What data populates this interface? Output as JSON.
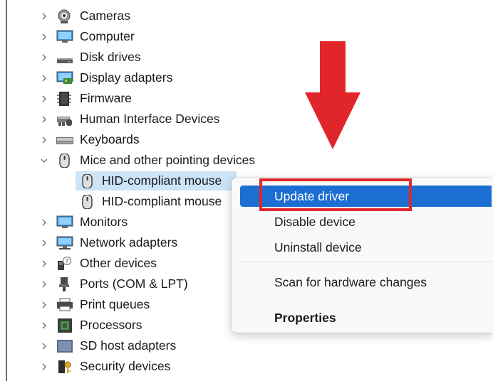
{
  "device_tree": {
    "items": [
      {
        "label": "Cameras",
        "icon": "camera-icon",
        "expanded": false
      },
      {
        "label": "Computer",
        "icon": "computer-icon",
        "expanded": false
      },
      {
        "label": "Disk drives",
        "icon": "disk-drive-icon",
        "expanded": false
      },
      {
        "label": "Display adapters",
        "icon": "display-adapter-icon",
        "expanded": false
      },
      {
        "label": "Firmware",
        "icon": "firmware-icon",
        "expanded": false
      },
      {
        "label": "Human Interface Devices",
        "icon": "hid-icon",
        "expanded": false
      },
      {
        "label": "Keyboards",
        "icon": "keyboard-icon",
        "expanded": false
      },
      {
        "label": "Mice and other pointing devices",
        "icon": "mouse-icon",
        "expanded": true,
        "children": [
          {
            "label": "HID-compliant mouse",
            "icon": "mouse-icon",
            "selected": true
          },
          {
            "label": "HID-compliant mouse",
            "icon": "mouse-icon",
            "selected": false
          }
        ]
      },
      {
        "label": "Monitors",
        "icon": "monitor-icon",
        "expanded": false
      },
      {
        "label": "Network adapters",
        "icon": "network-adapter-icon",
        "expanded": false
      },
      {
        "label": "Other devices",
        "icon": "other-devices-icon",
        "expanded": false
      },
      {
        "label": "Ports (COM & LPT)",
        "icon": "port-icon",
        "expanded": false
      },
      {
        "label": "Print queues",
        "icon": "printer-icon",
        "expanded": false
      },
      {
        "label": "Processors",
        "icon": "processor-icon",
        "expanded": false
      },
      {
        "label": "SD host adapters",
        "icon": "sd-adapter-icon",
        "expanded": false
      },
      {
        "label": "Security devices",
        "icon": "security-device-icon",
        "expanded": false
      }
    ]
  },
  "context_menu": {
    "items": [
      {
        "label": "Update driver",
        "highlighted": true,
        "bold": false
      },
      {
        "label": "Disable device",
        "highlighted": false,
        "bold": false
      },
      {
        "label": "Uninstall device",
        "highlighted": false,
        "bold": false
      },
      {
        "label": "Scan for hardware changes",
        "highlighted": false,
        "bold": false
      },
      {
        "label": "Properties",
        "highlighted": false,
        "bold": true
      }
    ]
  },
  "annotations": {
    "arrow_color": "#e0262a",
    "box_color": "#e0262a"
  },
  "colors": {
    "selection": "#cde4f7",
    "menu_highlight": "#1c6ed2"
  }
}
